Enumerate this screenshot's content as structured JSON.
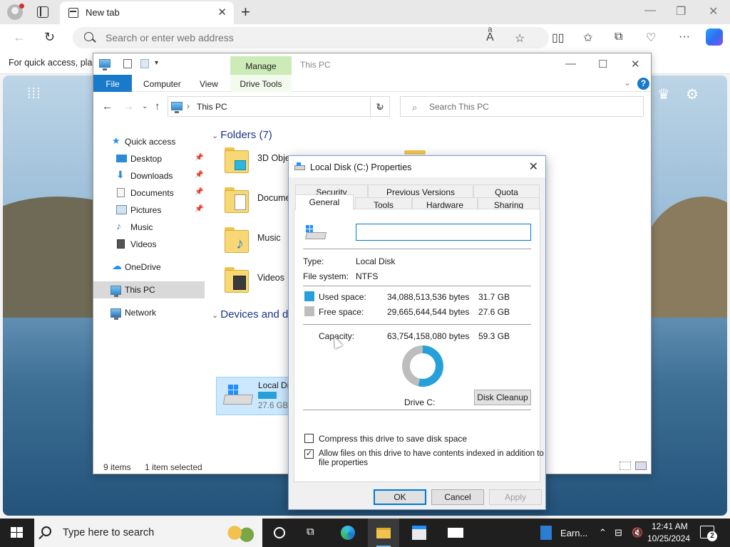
{
  "browser": {
    "tab_title": "New tab",
    "address_placeholder": "Search or enter web address",
    "favorites_bar_text": "For quick access, plac"
  },
  "explorer": {
    "window_title": "This PC",
    "manage_label": "Manage",
    "ribbon_tabs": [
      "File",
      "Computer",
      "View",
      "Drive Tools"
    ],
    "address_path": "This PC",
    "search_placeholder": "Search This PC",
    "nav_items": [
      {
        "label": "Quick access",
        "icon": "star-icon"
      },
      {
        "label": "Desktop",
        "icon": "desktop-icon",
        "pinned": true
      },
      {
        "label": "Downloads",
        "icon": "download-icon",
        "pinned": true
      },
      {
        "label": "Documents",
        "icon": "document-icon",
        "pinned": true
      },
      {
        "label": "Pictures",
        "icon": "pictures-icon",
        "pinned": true
      },
      {
        "label": "Music",
        "icon": "music-icon"
      },
      {
        "label": "Videos",
        "icon": "video-icon"
      },
      {
        "label": "OneDrive",
        "icon": "cloud-icon"
      },
      {
        "label": "This PC",
        "icon": "computer-icon",
        "selected": true
      },
      {
        "label": "Network",
        "icon": "network-icon"
      }
    ],
    "folders_header": "Folders (7)",
    "folders": [
      "3D Objec",
      "Docume",
      "Music",
      "Videos"
    ],
    "devices_header": "Devices and d",
    "drive": {
      "label": "Local Di",
      "free": "27.6 GB",
      "used_fraction": 0.535
    },
    "status_items": "9 items",
    "status_selected": "1 item selected"
  },
  "dialog": {
    "title": "Local Disk (C:) Properties",
    "tabs_row1": [
      "Security",
      "Previous Versions",
      "Quota"
    ],
    "tabs_row2": [
      "General",
      "Tools",
      "Hardware",
      "Sharing"
    ],
    "active_tab": "General",
    "name_value": "",
    "type_label": "Type:",
    "type_value": "Local Disk",
    "fs_label": "File system:",
    "fs_value": "NTFS",
    "used_label": "Used space:",
    "used_bytes": "34,088,513,536 bytes",
    "used_gb": "31.7 GB",
    "free_label": "Free space:",
    "free_bytes": "29,665,644,544 bytes",
    "free_gb": "27.6 GB",
    "capacity_label": "Capacity:",
    "capacity_bytes": "63,754,158,080 bytes",
    "capacity_gb": "59.3 GB",
    "drive_caption": "Drive C:",
    "cleanup_button": "Disk Cleanup",
    "compress_label": "Compress this drive to save disk space",
    "compress_checked": false,
    "index_label_line1": "Allow files on this drive to have contents indexed in addition to",
    "index_label_line2": "file properties",
    "index_checked": true,
    "ok_button": "OK",
    "cancel_button": "Cancel",
    "apply_button": "Apply",
    "colors": {
      "used": "#26a0da",
      "free": "#bdbdbd"
    }
  },
  "taskbar": {
    "search_placeholder": "Type here to search",
    "app_label": "Earn...",
    "time": "12:41 AM",
    "date": "10/25/2024",
    "notification_count": "2"
  }
}
